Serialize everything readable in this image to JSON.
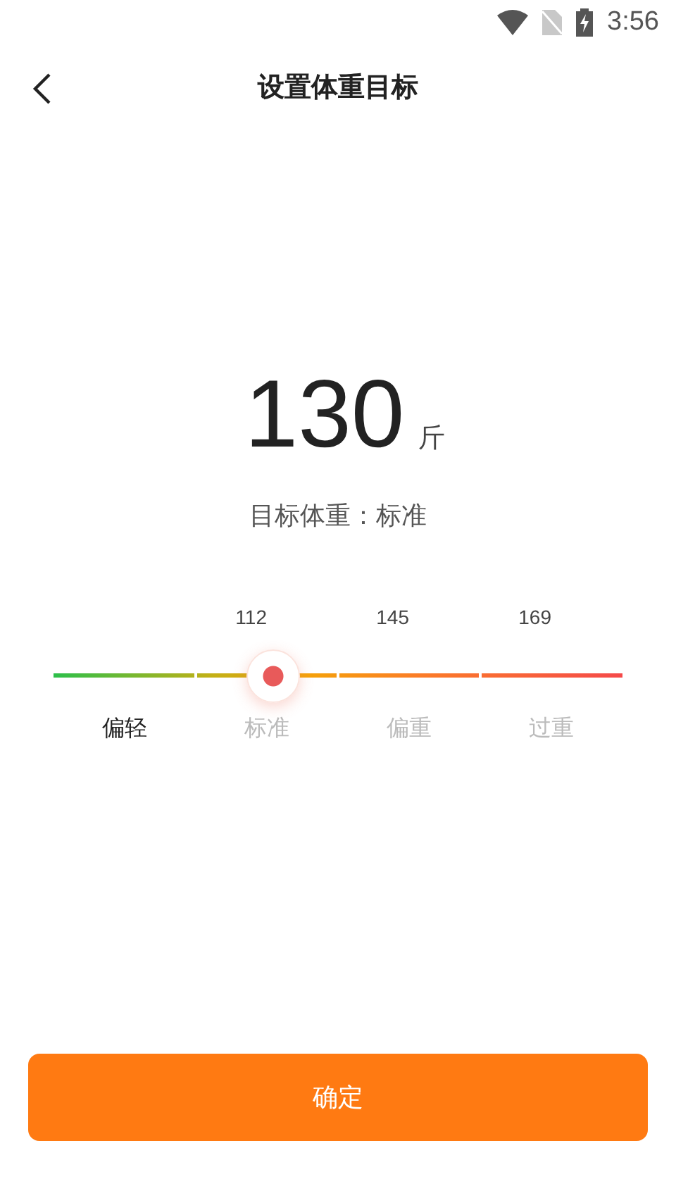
{
  "status_bar": {
    "time": "3:56"
  },
  "header": {
    "title": "设置体重目标"
  },
  "weight": {
    "value": "130",
    "unit": "斤",
    "status": "目标体重：标准"
  },
  "scale": {
    "level": 0.386,
    "ticks": [
      "112",
      "145",
      "169"
    ],
    "ranges": [
      {
        "label": "偏轻",
        "selected": true
      },
      {
        "label": "标准",
        "selected": false
      },
      {
        "label": "偏重",
        "selected": false
      },
      {
        "label": "过重",
        "selected": false
      }
    ]
  },
  "confirm_button": {
    "label": "确定"
  }
}
